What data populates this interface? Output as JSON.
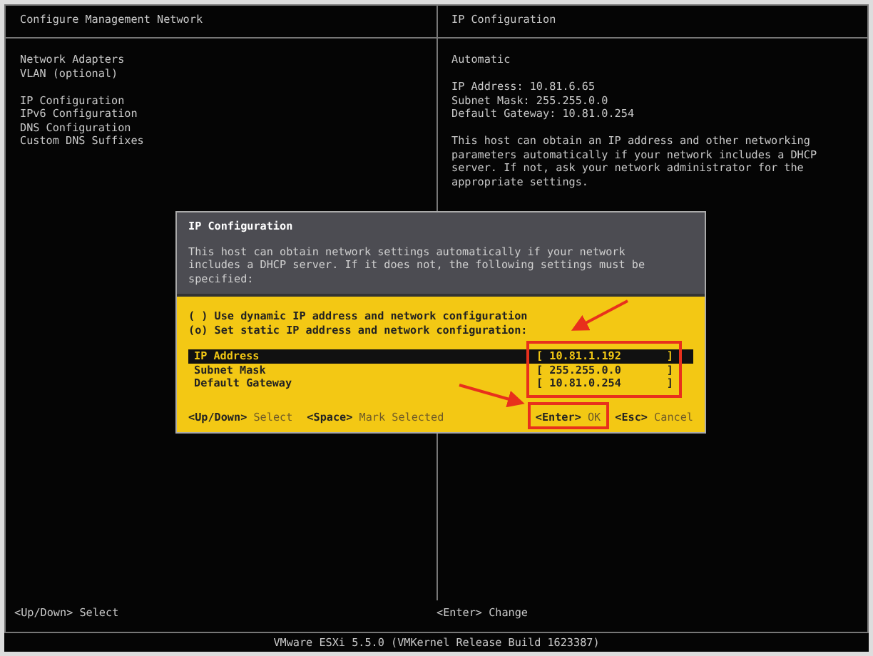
{
  "left_pane": {
    "title": "Configure Management Network",
    "groups": [
      {
        "items": [
          "Network Adapters",
          "VLAN (optional)"
        ]
      },
      {
        "items": [
          "IP Configuration",
          "IPv6 Configuration",
          "DNS Configuration",
          "Custom DNS Suffixes"
        ]
      }
    ]
  },
  "right_pane": {
    "title": "IP Configuration",
    "mode": "Automatic",
    "details": [
      "IP Address: 10.81.6.65",
      "Subnet Mask: 255.255.0.0",
      "Default Gateway: 10.81.0.254"
    ],
    "description": "This host can obtain an IP address and other networking parameters automatically if your network includes a DHCP server. If not, ask your network administrator for the appropriate settings."
  },
  "dialog": {
    "title": "IP Configuration",
    "description": "This host can obtain network settings automatically if your network includes a DHCP server. If it does not, the following settings must be specified:",
    "options": [
      "( ) Use dynamic IP address and network configuration",
      "(o) Set static IP address and network configuration:"
    ],
    "fields": [
      {
        "label": "IP Address",
        "value": "[ 10.81.1.192       ]",
        "selected": true
      },
      {
        "label": "Subnet Mask",
        "value": "[ 255.255.0.0       ]",
        "selected": false
      },
      {
        "label": "Default Gateway",
        "value": "[ 10.81.0.254       ]",
        "selected": false
      }
    ],
    "hints_left": [
      {
        "key": "<Up/Down>",
        "action": "Select"
      },
      {
        "key": "<Space>",
        "action": "Mark Selected"
      }
    ],
    "hints_right": [
      {
        "key": "<Enter>",
        "action": "OK"
      },
      {
        "key": "<Esc>",
        "action": "Cancel"
      }
    ]
  },
  "bottom_bar": [
    {
      "key": "<Up/Down>",
      "action": "Select"
    },
    {
      "key": "<Enter>",
      "action": "Change"
    }
  ],
  "status_line": "VMware ESXi 5.5.0 (VMKernel Release Build 1623387)"
}
